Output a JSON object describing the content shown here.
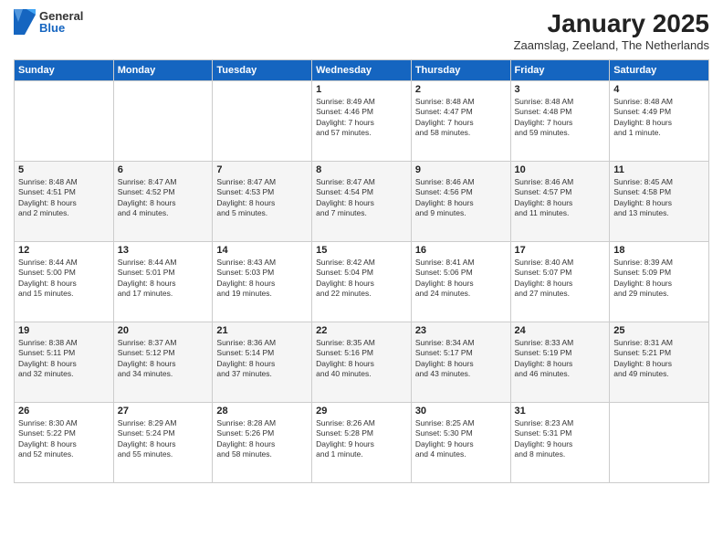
{
  "logo": {
    "general": "General",
    "blue": "Blue"
  },
  "title": "January 2025",
  "subtitle": "Zaamslag, Zeeland, The Netherlands",
  "weekdays": [
    "Sunday",
    "Monday",
    "Tuesday",
    "Wednesday",
    "Thursday",
    "Friday",
    "Saturday"
  ],
  "weeks": [
    [
      {
        "day": "",
        "info": ""
      },
      {
        "day": "",
        "info": ""
      },
      {
        "day": "",
        "info": ""
      },
      {
        "day": "1",
        "info": "Sunrise: 8:49 AM\nSunset: 4:46 PM\nDaylight: 7 hours\nand 57 minutes."
      },
      {
        "day": "2",
        "info": "Sunrise: 8:48 AM\nSunset: 4:47 PM\nDaylight: 7 hours\nand 58 minutes."
      },
      {
        "day": "3",
        "info": "Sunrise: 8:48 AM\nSunset: 4:48 PM\nDaylight: 7 hours\nand 59 minutes."
      },
      {
        "day": "4",
        "info": "Sunrise: 8:48 AM\nSunset: 4:49 PM\nDaylight: 8 hours\nand 1 minute."
      }
    ],
    [
      {
        "day": "5",
        "info": "Sunrise: 8:48 AM\nSunset: 4:51 PM\nDaylight: 8 hours\nand 2 minutes."
      },
      {
        "day": "6",
        "info": "Sunrise: 8:47 AM\nSunset: 4:52 PM\nDaylight: 8 hours\nand 4 minutes."
      },
      {
        "day": "7",
        "info": "Sunrise: 8:47 AM\nSunset: 4:53 PM\nDaylight: 8 hours\nand 5 minutes."
      },
      {
        "day": "8",
        "info": "Sunrise: 8:47 AM\nSunset: 4:54 PM\nDaylight: 8 hours\nand 7 minutes."
      },
      {
        "day": "9",
        "info": "Sunrise: 8:46 AM\nSunset: 4:56 PM\nDaylight: 8 hours\nand 9 minutes."
      },
      {
        "day": "10",
        "info": "Sunrise: 8:46 AM\nSunset: 4:57 PM\nDaylight: 8 hours\nand 11 minutes."
      },
      {
        "day": "11",
        "info": "Sunrise: 8:45 AM\nSunset: 4:58 PM\nDaylight: 8 hours\nand 13 minutes."
      }
    ],
    [
      {
        "day": "12",
        "info": "Sunrise: 8:44 AM\nSunset: 5:00 PM\nDaylight: 8 hours\nand 15 minutes."
      },
      {
        "day": "13",
        "info": "Sunrise: 8:44 AM\nSunset: 5:01 PM\nDaylight: 8 hours\nand 17 minutes."
      },
      {
        "day": "14",
        "info": "Sunrise: 8:43 AM\nSunset: 5:03 PM\nDaylight: 8 hours\nand 19 minutes."
      },
      {
        "day": "15",
        "info": "Sunrise: 8:42 AM\nSunset: 5:04 PM\nDaylight: 8 hours\nand 22 minutes."
      },
      {
        "day": "16",
        "info": "Sunrise: 8:41 AM\nSunset: 5:06 PM\nDaylight: 8 hours\nand 24 minutes."
      },
      {
        "day": "17",
        "info": "Sunrise: 8:40 AM\nSunset: 5:07 PM\nDaylight: 8 hours\nand 27 minutes."
      },
      {
        "day": "18",
        "info": "Sunrise: 8:39 AM\nSunset: 5:09 PM\nDaylight: 8 hours\nand 29 minutes."
      }
    ],
    [
      {
        "day": "19",
        "info": "Sunrise: 8:38 AM\nSunset: 5:11 PM\nDaylight: 8 hours\nand 32 minutes."
      },
      {
        "day": "20",
        "info": "Sunrise: 8:37 AM\nSunset: 5:12 PM\nDaylight: 8 hours\nand 34 minutes."
      },
      {
        "day": "21",
        "info": "Sunrise: 8:36 AM\nSunset: 5:14 PM\nDaylight: 8 hours\nand 37 minutes."
      },
      {
        "day": "22",
        "info": "Sunrise: 8:35 AM\nSunset: 5:16 PM\nDaylight: 8 hours\nand 40 minutes."
      },
      {
        "day": "23",
        "info": "Sunrise: 8:34 AM\nSunset: 5:17 PM\nDaylight: 8 hours\nand 43 minutes."
      },
      {
        "day": "24",
        "info": "Sunrise: 8:33 AM\nSunset: 5:19 PM\nDaylight: 8 hours\nand 46 minutes."
      },
      {
        "day": "25",
        "info": "Sunrise: 8:31 AM\nSunset: 5:21 PM\nDaylight: 8 hours\nand 49 minutes."
      }
    ],
    [
      {
        "day": "26",
        "info": "Sunrise: 8:30 AM\nSunset: 5:22 PM\nDaylight: 8 hours\nand 52 minutes."
      },
      {
        "day": "27",
        "info": "Sunrise: 8:29 AM\nSunset: 5:24 PM\nDaylight: 8 hours\nand 55 minutes."
      },
      {
        "day": "28",
        "info": "Sunrise: 8:28 AM\nSunset: 5:26 PM\nDaylight: 8 hours\nand 58 minutes."
      },
      {
        "day": "29",
        "info": "Sunrise: 8:26 AM\nSunset: 5:28 PM\nDaylight: 9 hours\nand 1 minute."
      },
      {
        "day": "30",
        "info": "Sunrise: 8:25 AM\nSunset: 5:30 PM\nDaylight: 9 hours\nand 4 minutes."
      },
      {
        "day": "31",
        "info": "Sunrise: 8:23 AM\nSunset: 5:31 PM\nDaylight: 9 hours\nand 8 minutes."
      },
      {
        "day": "",
        "info": ""
      }
    ]
  ]
}
